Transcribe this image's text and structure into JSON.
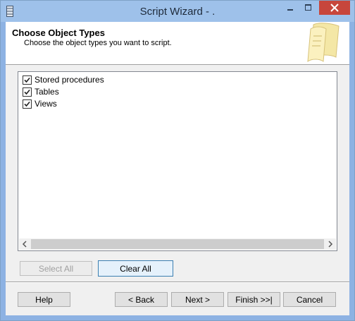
{
  "window": {
    "title": "Script Wizard - ."
  },
  "header": {
    "title": "Choose Object Types",
    "subtitle": "Choose the object types you want to script."
  },
  "object_types": [
    {
      "label": "Stored procedures",
      "checked": true
    },
    {
      "label": "Tables",
      "checked": true
    },
    {
      "label": "Views",
      "checked": true
    }
  ],
  "selection_buttons": {
    "select_all": "Select All",
    "clear_all": "Clear All"
  },
  "footer": {
    "help": "Help",
    "back": "< Back",
    "next": "Next >",
    "finish": "Finish >>|",
    "cancel": "Cancel"
  },
  "icons": {
    "app": "database-icon",
    "header": "scroll-paper-icon",
    "minimize": "minimize-icon",
    "maximize": "maximize-icon",
    "close": "close-icon"
  },
  "colors": {
    "titlebar": "#9ec1ea",
    "close_button": "#c7463c",
    "focus_border": "#3c7fb1"
  }
}
